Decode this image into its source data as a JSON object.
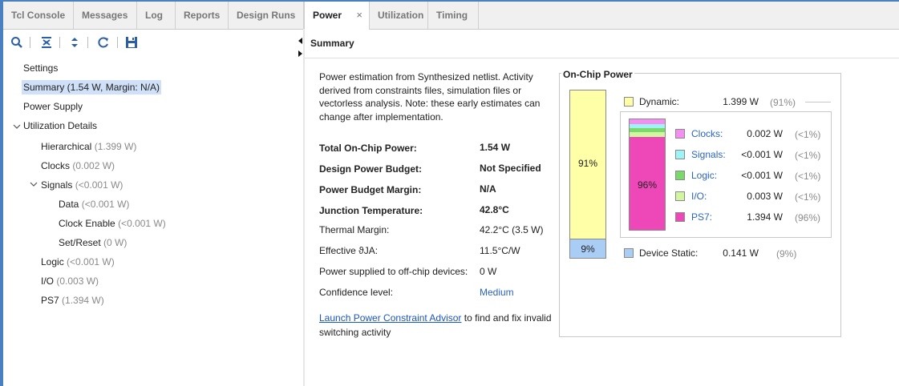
{
  "tabs": [
    {
      "label": "Tcl Console"
    },
    {
      "label": "Messages"
    },
    {
      "label": "Log"
    },
    {
      "label": "Reports"
    },
    {
      "label": "Design Runs"
    },
    {
      "label": "Power",
      "active": true,
      "close": "×"
    },
    {
      "label": "Utilization"
    },
    {
      "label": "Timing"
    }
  ],
  "toolbar": {
    "icons": [
      "search-icon",
      "collapse-all-icon",
      "expand-all-icon",
      "refresh-icon",
      "save-icon"
    ]
  },
  "tree": {
    "settings": "Settings",
    "summary": "Summary (1.54 W, Margin: N/A)",
    "power_supply": "Power Supply",
    "utilization_details": "Utilization Details",
    "hierarchical": {
      "label": "Hierarchical",
      "value": "(1.399 W)"
    },
    "clocks": {
      "label": "Clocks",
      "value": "(0.002 W)"
    },
    "signals": {
      "label": "Signals",
      "value": "(<0.001 W)"
    },
    "data": {
      "label": "Data",
      "value": "(<0.001 W)"
    },
    "clock_enable": {
      "label": "Clock Enable",
      "value": "(<0.001 W)"
    },
    "set_reset": {
      "label": "Set/Reset",
      "value": "(0 W)"
    },
    "logic": {
      "label": "Logic",
      "value": "(<0.001 W)"
    },
    "io": {
      "label": "I/O",
      "value": "(0.003 W)"
    },
    "ps7": {
      "label": "PS7",
      "value": "(1.394 W)"
    }
  },
  "summary": {
    "header": "Summary",
    "intro": "Power estimation from Synthesized netlist. Activity derived from constraints files, simulation files or vectorless analysis. Note: these early estimates can change after implementation.",
    "rows": [
      {
        "label": "Total On-Chip Power:",
        "value": "1.54 W"
      },
      {
        "label": "Design Power Budget:",
        "value": "Not Specified"
      },
      {
        "label": "Power Budget Margin:",
        "value": "N/A"
      },
      {
        "label": "Junction Temperature:",
        "value": "42.8°C"
      },
      {
        "label": "Thermal Margin:",
        "value": "42.2°C (3.5 W)"
      },
      {
        "label": "Effective ϑJA:",
        "value": "11.5°C/W"
      },
      {
        "label": "Power supplied to off-chip devices:",
        "value": "0 W"
      },
      {
        "label": "Confidence level:",
        "value": "Medium"
      }
    ],
    "advisor_link": "Launch Power Constraint Advisor",
    "advisor_text": " to find and fix invalid switching activity"
  },
  "on_chip_power": {
    "title": "On-Chip Power",
    "dynamic": {
      "label": "Dynamic:",
      "value": "1.399 W",
      "pct": "(91%)",
      "bar_pct": "91%",
      "fraction": 0.91,
      "color": "#ffffa8"
    },
    "static": {
      "label": "Device Static:",
      "value": "0.141 W",
      "pct": "(9%)",
      "bar_pct": "9%",
      "fraction": 0.09,
      "color": "#a9cdf4"
    },
    "sub_bar_label": "96%",
    "breakdown": [
      {
        "label": "Clocks:",
        "value": "0.002 W",
        "pct": "(<1%)",
        "color": "#f48ef0",
        "fraction": 0.04
      },
      {
        "label": "Signals:",
        "value": "<0.001 W",
        "pct": "(<1%)",
        "color": "#9ef4f4",
        "fraction": 0.04
      },
      {
        "label": "Logic:",
        "value": "<0.001 W",
        "pct": "(<1%)",
        "color": "#7bd86a",
        "fraction": 0.04
      },
      {
        "label": "I/O:",
        "value": "0.003 W",
        "pct": "(<1%)",
        "color": "#d2f5a0",
        "fraction": 0.04
      },
      {
        "label": "PS7:",
        "value": "1.394 W",
        "pct": "(96%)",
        "color": "#ee48b8",
        "fraction": 0.84
      }
    ]
  }
}
